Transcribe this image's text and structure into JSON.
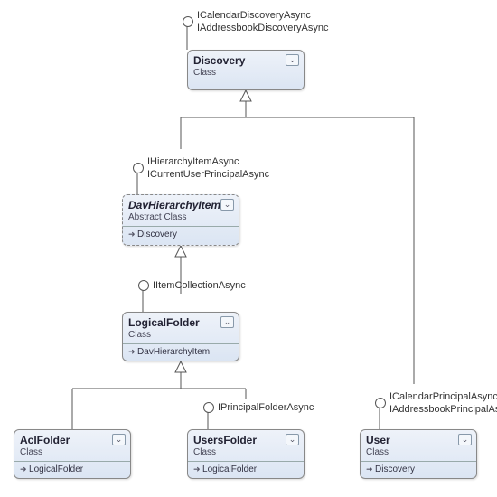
{
  "classes": {
    "discovery": {
      "name": "Discovery",
      "stereotype": "Class"
    },
    "davHierarchyItem": {
      "name": "DavHierarchyItem",
      "stereotype": "Abstract Class",
      "inherits": "Discovery"
    },
    "logicalFolder": {
      "name": "LogicalFolder",
      "stereotype": "Class",
      "inherits": "DavHierarchyItem"
    },
    "aclFolder": {
      "name": "AclFolder",
      "stereotype": "Class",
      "inherits": "LogicalFolder"
    },
    "usersFolder": {
      "name": "UsersFolder",
      "stereotype": "Class",
      "inherits": "LogicalFolder"
    },
    "user": {
      "name": "User",
      "stereotype": "Class",
      "inherits": "Discovery"
    }
  },
  "interfaces": {
    "discovery1": "ICalendarDiscoveryAsync",
    "discovery2": "IAddressbookDiscoveryAsync",
    "dav1": "IHierarchyItemAsync",
    "dav2": "ICurrentUserPrincipalAsync",
    "logical1": "IItemCollectionAsync",
    "usersFolder1": "IPrincipalFolderAsync",
    "user1": "ICalendarPrincipalAsync",
    "user2": "IAddressbookPrincipalAsync"
  },
  "chart_data": {
    "type": "uml-class-diagram",
    "nodes": [
      {
        "id": "Discovery",
        "kind": "Class",
        "implements": [
          "ICalendarDiscoveryAsync",
          "IAddressbookDiscoveryAsync"
        ]
      },
      {
        "id": "DavHierarchyItem",
        "kind": "Abstract Class",
        "extends": "Discovery",
        "implements": [
          "IHierarchyItemAsync",
          "ICurrentUserPrincipalAsync"
        ]
      },
      {
        "id": "LogicalFolder",
        "kind": "Class",
        "extends": "DavHierarchyItem",
        "implements": [
          "IItemCollectionAsync"
        ]
      },
      {
        "id": "AclFolder",
        "kind": "Class",
        "extends": "LogicalFolder"
      },
      {
        "id": "UsersFolder",
        "kind": "Class",
        "extends": "LogicalFolder",
        "implements": [
          "IPrincipalFolderAsync"
        ]
      },
      {
        "id": "User",
        "kind": "Class",
        "extends": "Discovery",
        "implements": [
          "ICalendarPrincipalAsync",
          "IAddressbookPrincipalAsync"
        ]
      }
    ],
    "edges": [
      {
        "from": "DavHierarchyItem",
        "to": "Discovery",
        "rel": "extends"
      },
      {
        "from": "LogicalFolder",
        "to": "DavHierarchyItem",
        "rel": "extends"
      },
      {
        "from": "AclFolder",
        "to": "LogicalFolder",
        "rel": "extends"
      },
      {
        "from": "UsersFolder",
        "to": "LogicalFolder",
        "rel": "extends"
      },
      {
        "from": "User",
        "to": "Discovery",
        "rel": "extends"
      }
    ]
  }
}
